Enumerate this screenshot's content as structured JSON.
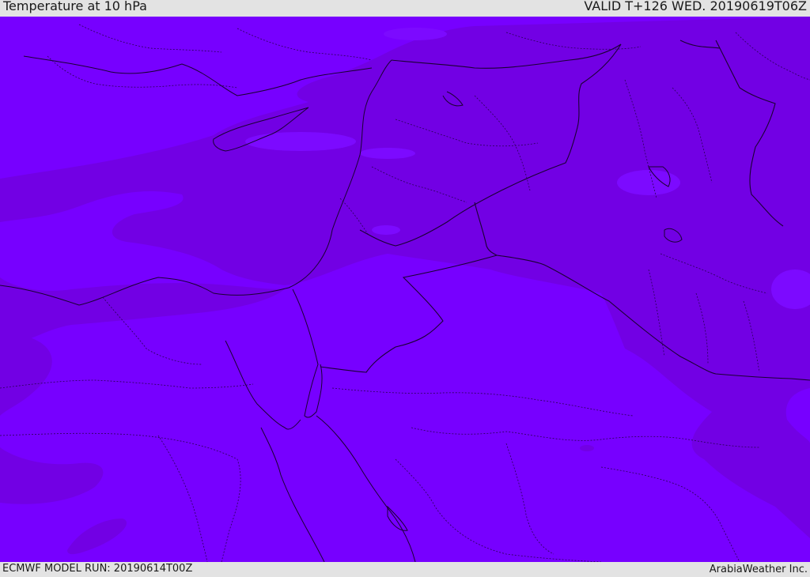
{
  "header": {
    "title": "Temperature at 10 hPa",
    "valid_time": "VALID T+126 WED. 20190619T06Z"
  },
  "footer": {
    "model_run": "ECMWF MODEL RUN: 20190614T00Z",
    "credit": "ArabiaWeather Inc."
  },
  "colors": {
    "field_primary": "#7700ff",
    "field_secondary": "#7200e4",
    "field_light": "#7c0aff",
    "borders": "#1b0033"
  }
}
